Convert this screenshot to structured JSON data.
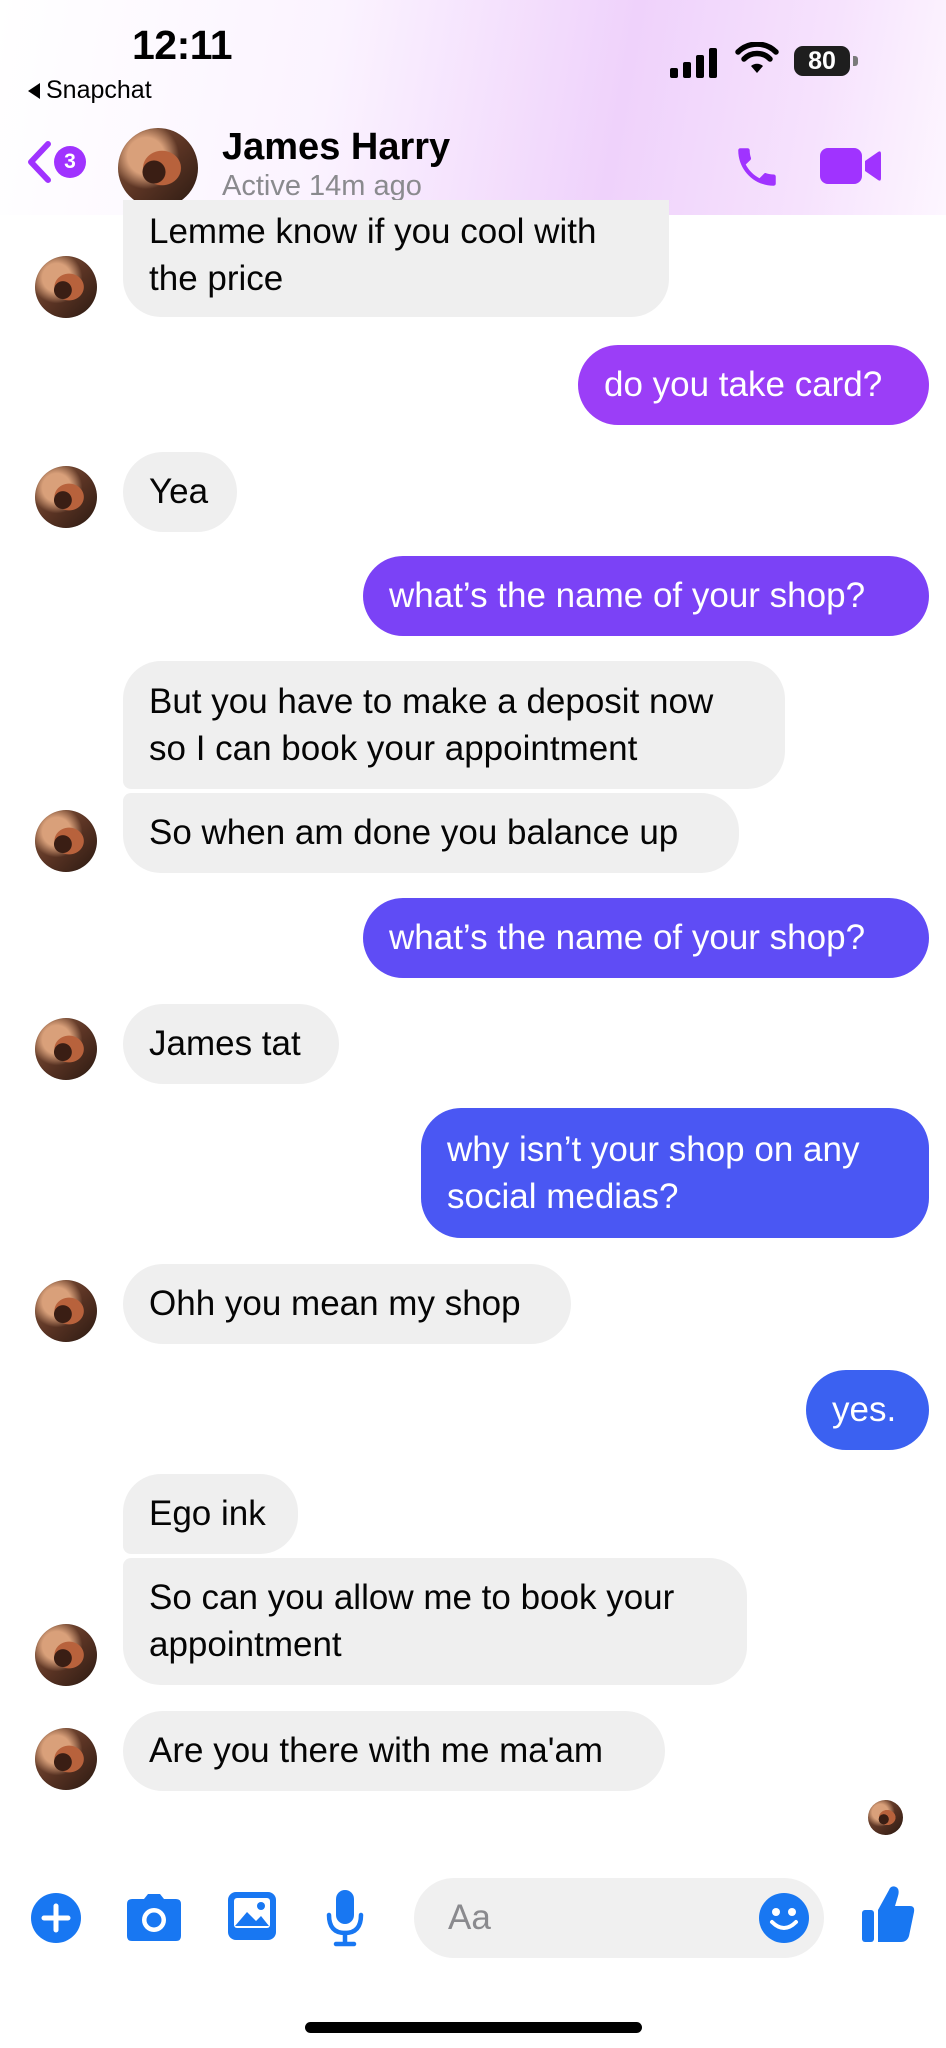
{
  "status_bar": {
    "time": "12:11",
    "back_app": "Snapchat",
    "battery": "80"
  },
  "header": {
    "back_badge": "3",
    "name": "James Harry",
    "status": "Active 14m ago"
  },
  "colors": {
    "accent": "#a033ff",
    "messenger_blue": "#1877f2"
  },
  "messages": [
    {
      "from": "them",
      "text_lines": [
        "Lemme know if you cool with",
        "the price"
      ]
    },
    {
      "from": "me",
      "text_lines": [
        "do you take card?"
      ]
    },
    {
      "from": "them",
      "text_lines": [
        "Yea"
      ]
    },
    {
      "from": "me",
      "text_lines": [
        "what’s the name of your shop?"
      ]
    },
    {
      "from": "them",
      "text_lines": [
        "But you have to make a deposit now",
        "so I can book your appointment"
      ]
    },
    {
      "from": "them",
      "text_lines": [
        "So when am done you balance up"
      ]
    },
    {
      "from": "me",
      "text_lines": [
        "what’s the name of your shop?"
      ]
    },
    {
      "from": "them",
      "text_lines": [
        "James tat"
      ]
    },
    {
      "from": "me",
      "text_lines": [
        "why isn’t your shop on any",
        "social medias?"
      ]
    },
    {
      "from": "them",
      "text_lines": [
        "Ohh you mean my shop"
      ]
    },
    {
      "from": "me",
      "text_lines": [
        "yes."
      ]
    },
    {
      "from": "them",
      "text_lines": [
        "Ego ink"
      ]
    },
    {
      "from": "them",
      "text_lines": [
        "So can you allow me to book your",
        "appointment"
      ]
    },
    {
      "from": "them",
      "text_lines": [
        "Are you there with me ma'am"
      ]
    }
  ],
  "composer": {
    "placeholder": "Aa",
    "icons": [
      "plus-icon",
      "camera-icon",
      "image-icon",
      "microphone-icon",
      "emoji-icon",
      "thumbs-up-icon"
    ]
  }
}
